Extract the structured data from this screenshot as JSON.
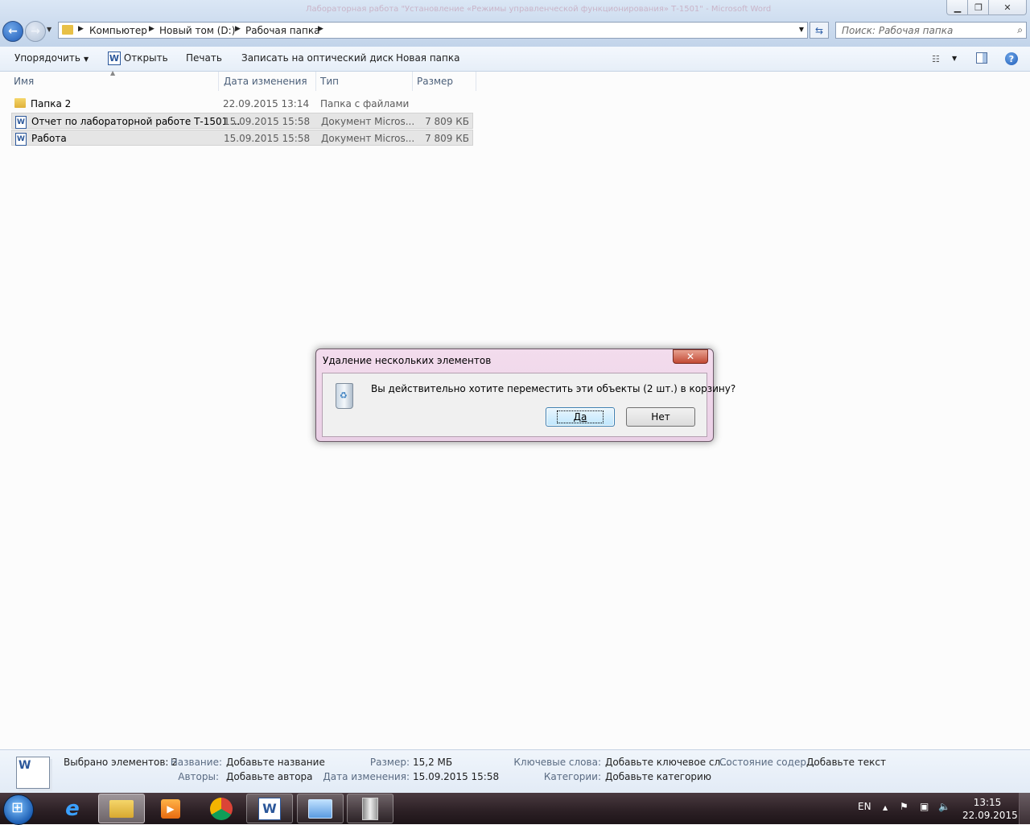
{
  "window": {
    "ghost_title": "Лабораторная работа \"Установление «Режимы управленческой функционирования» Т-1501\" - Microsoft Word"
  },
  "address": {
    "crumbs": [
      "Компьютер",
      "Новый том (D:)",
      "Рабочая папка"
    ]
  },
  "search": {
    "placeholder": "Поиск: Рабочая папка"
  },
  "toolbar": {
    "organize": "Упорядочить",
    "open": "Открыть",
    "print": "Печать",
    "burn": "Записать на оптический диск",
    "new_folder": "Новая папка"
  },
  "columns": {
    "name": "Имя",
    "date": "Дата изменения",
    "type": "Тип",
    "size": "Размер"
  },
  "files": [
    {
      "name": "Папка 2",
      "date": "22.09.2015 13:14",
      "type": "Папка с файлами",
      "size": "",
      "icon": "folder-icon"
    },
    {
      "name": "Отчет по лабораторной работе Т-1501 ...",
      "date": "15.09.2015 15:58",
      "type": "Документ Micros...",
      "size": "7 809 КБ",
      "icon": "word-doc-icon"
    },
    {
      "name": "Работа",
      "date": "15.09.2015 15:58",
      "type": "Документ Micros...",
      "size": "7 809 КБ",
      "icon": "word-doc-icon"
    }
  ],
  "dialog": {
    "title": "Удаление нескольких элементов",
    "message": "Вы действительно хотите переместить эти объекты (2 шт.) в корзину?",
    "yes": "Да",
    "no": "Нет"
  },
  "details": {
    "selected": "Выбрано элементов: 2",
    "title_label": "Название:",
    "title_value": "Добавьте название",
    "authors_label": "Авторы:",
    "authors_value": "Добавьте автора",
    "size_label": "Размер:",
    "size_value": "15,2 МБ",
    "modified_label": "Дата изменения:",
    "modified_value": "15.09.2015 15:58",
    "keywords_label": "Ключевые слова:",
    "keywords_value": "Добавьте ключевое сл...",
    "categories_label": "Категории:",
    "categories_value": "Добавьте категорию",
    "content_status_label": "Состояние содер...",
    "content_status_value": "Добавьте текст"
  },
  "taskbar": {
    "lang": "EN",
    "time": "13:15",
    "date": "22.09.2015"
  }
}
